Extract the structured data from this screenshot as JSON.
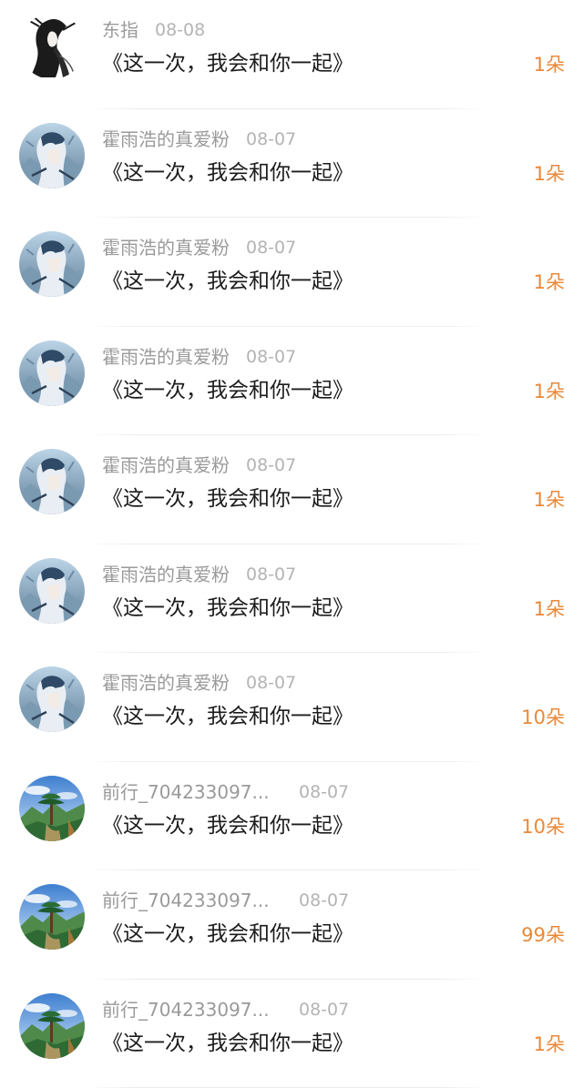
{
  "colors": {
    "accent_count": "#e8893a",
    "name_text": "#9a9a9a",
    "date_text": "#b4b4b4",
    "message_text": "#1c1c1c",
    "divider": "#ececec"
  },
  "items": [
    {
      "avatar": "ink-sketch-avatar",
      "name": "东指",
      "date": "08-08",
      "message": "《这一次，我会和你一起》",
      "count": "1朵"
    },
    {
      "avatar": "blue-anime-avatar",
      "name": "霍雨浩的真爱粉",
      "date": "08-07",
      "message": "《这一次，我会和你一起》",
      "count": "1朵"
    },
    {
      "avatar": "blue-anime-avatar",
      "name": "霍雨浩的真爱粉",
      "date": "08-07",
      "message": "《这一次，我会和你一起》",
      "count": "1朵"
    },
    {
      "avatar": "blue-anime-avatar",
      "name": "霍雨浩的真爱粉",
      "date": "08-07",
      "message": "《这一次，我会和你一起》",
      "count": "1朵"
    },
    {
      "avatar": "blue-anime-avatar",
      "name": "霍雨浩的真爱粉",
      "date": "08-07",
      "message": "《这一次，我会和你一起》",
      "count": "1朵"
    },
    {
      "avatar": "blue-anime-avatar",
      "name": "霍雨浩的真爱粉",
      "date": "08-07",
      "message": "《这一次，我会和你一起》",
      "count": "1朵"
    },
    {
      "avatar": "blue-anime-avatar",
      "name": "霍雨浩的真爱粉",
      "date": "08-07",
      "message": "《这一次，我会和你一起》",
      "count": "10朵"
    },
    {
      "avatar": "pine-landscape-avatar",
      "name": "前行_704233097...",
      "date": "08-07",
      "message": "《这一次，我会和你一起》",
      "count": "10朵"
    },
    {
      "avatar": "pine-landscape-avatar",
      "name": "前行_704233097...",
      "date": "08-07",
      "message": "《这一次，我会和你一起》",
      "count": "99朵"
    },
    {
      "avatar": "pine-landscape-avatar",
      "name": "前行_704233097...",
      "date": "08-07",
      "message": "《这一次，我会和你一起》",
      "count": "1朵"
    }
  ]
}
